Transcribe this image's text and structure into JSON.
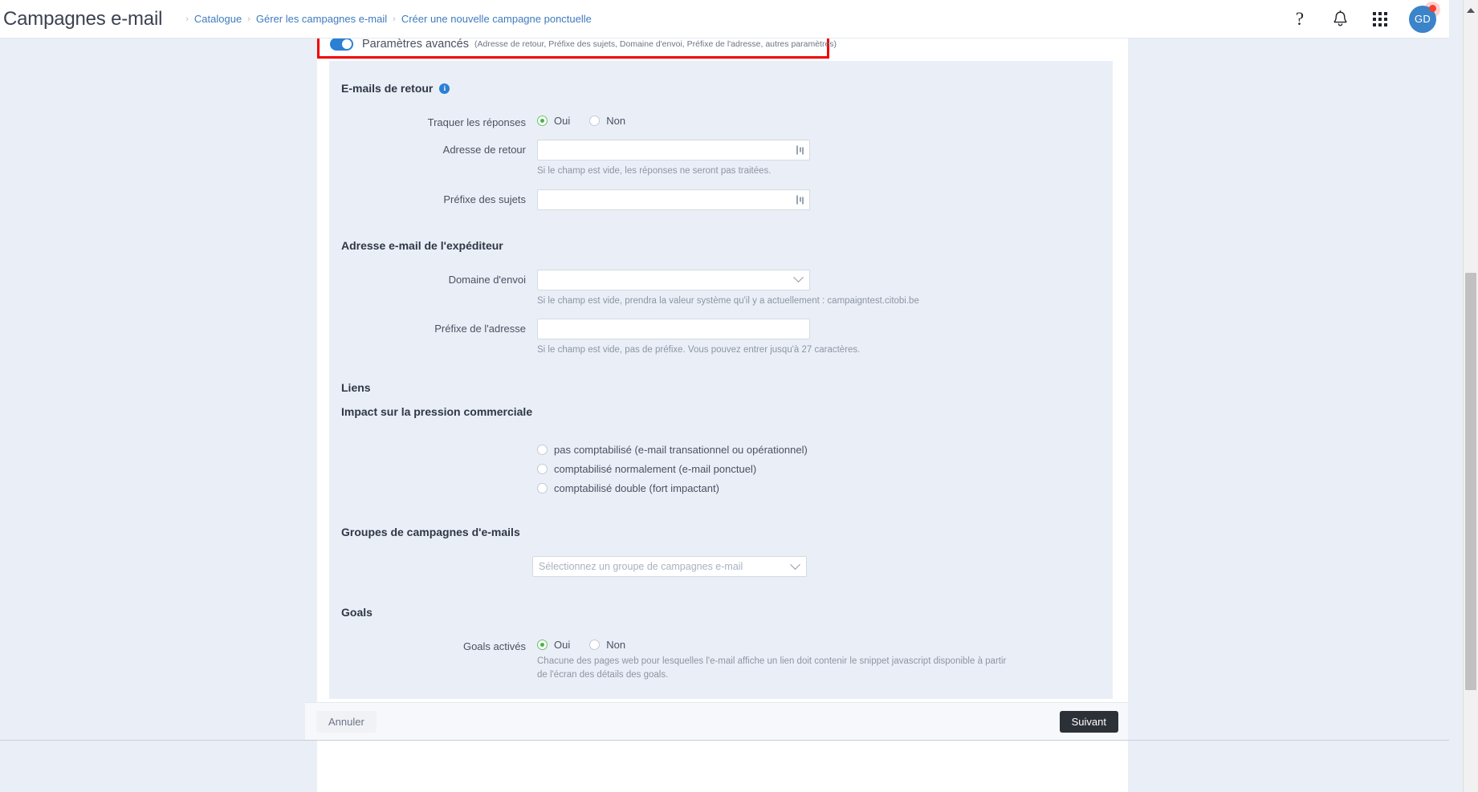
{
  "topbar": {
    "page_title": "Campagnes e-mail",
    "breadcrumb": [
      {
        "label": "Catalogue"
      },
      {
        "label": "Gérer les campagnes e-mail"
      },
      {
        "label": "Créer une nouvelle campagne ponctuelle"
      }
    ],
    "separator": "›",
    "icons": {
      "help": "?",
      "help_name": "help-icon",
      "bell_name": "notifications-bell-icon",
      "apps_name": "apps-grid-icon"
    },
    "avatar_initials": "GD"
  },
  "advanced": {
    "toggle_on": true,
    "label": "Paramètres avancés",
    "sublabel": "(Adresse de retour, Préfixe des sujets, Domaine d'envoi, Préfixe de l'adresse, autres paramètres)",
    "highlight_color": "#f20000"
  },
  "return_emails": {
    "title": "E-mails de retour",
    "track_replies": {
      "label": "Traquer les réponses",
      "options": [
        "Oui",
        "Non"
      ],
      "selected": "Oui"
    },
    "return_address": {
      "label": "Adresse de retour",
      "value": "",
      "placeholder": "",
      "hint": "Si le champ est vide, les réponses ne seront pas traitées."
    },
    "subject_prefix": {
      "label": "Préfixe des sujets",
      "value": "",
      "placeholder": "",
      "hint": ""
    }
  },
  "sender": {
    "title": "Adresse e-mail de l'expéditeur",
    "sending_domain": {
      "label": "Domaine d'envoi",
      "value": "",
      "hint": "Si le champ est vide, prendra la valeur système qu'il y a actuellement : campaigntest.citobi.be"
    },
    "address_prefix": {
      "label": "Préfixe de l'adresse",
      "value": "",
      "placeholder": "",
      "hint": "Si le champ est vide, pas de préfixe. Vous pouvez entrer jusqu'à 27 caractères."
    }
  },
  "links": {
    "title": "Liens"
  },
  "pressure": {
    "title": "Impact sur la pression commerciale",
    "options": [
      {
        "label": "pas comptabilisé (e-mail transationnel ou opérationnel)",
        "selected": false
      },
      {
        "label": "comptabilisé normalement (e-mail ponctuel)",
        "selected": false
      },
      {
        "label": "comptabilisé double (fort impactant)",
        "selected": false
      }
    ]
  },
  "campaign_groups": {
    "title": "Groupes de campagnes d'e-mails",
    "select": {
      "value": "",
      "placeholder": "Sélectionnez un groupe de campagnes e-mail"
    }
  },
  "goals": {
    "title": "Goals",
    "enabled": {
      "label": "Goals activés",
      "options": [
        "Oui",
        "Non"
      ],
      "selected": "Oui"
    },
    "hint": "Chacune des pages web pour lesquelles l'e-mail affiche un lien doit contenir le snippet javascript disponible à partir de l'écran des détails des goals."
  },
  "footer": {
    "cancel_label": "Annuler",
    "next_label": "Suivant"
  }
}
